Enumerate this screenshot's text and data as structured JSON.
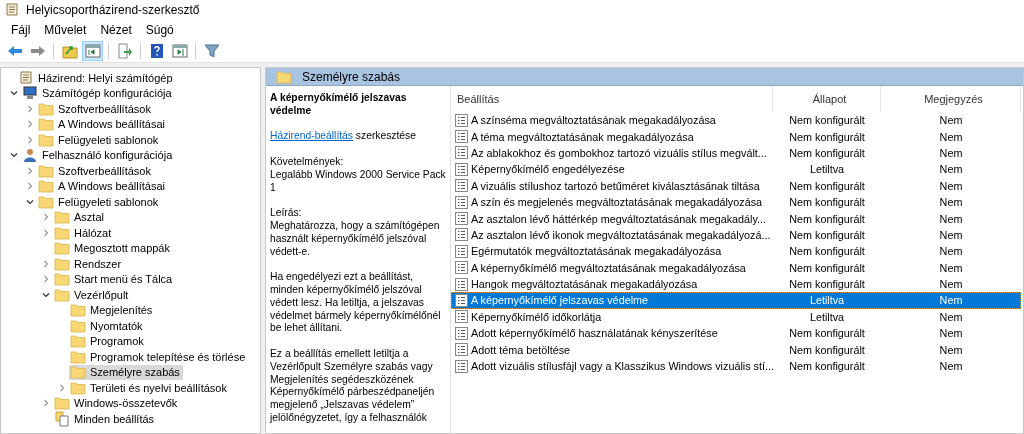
{
  "window": {
    "title": "Helyicsoportházirend-szerkesztő"
  },
  "menu": [
    "Fájl",
    "Művelet",
    "Nézet",
    "Súgó"
  ],
  "toolbar": [
    {
      "kind": "back",
      "pressed": false
    },
    {
      "kind": "forward",
      "pressed": false
    },
    {
      "kind": "separator"
    },
    {
      "kind": "up",
      "pressed": false
    },
    {
      "kind": "tree",
      "pressed": true
    },
    {
      "kind": "separator"
    },
    {
      "kind": "export",
      "pressed": false
    },
    {
      "kind": "separator"
    },
    {
      "kind": "help",
      "pressed": false
    },
    {
      "kind": "pane",
      "pressed": false
    },
    {
      "kind": "separator"
    },
    {
      "kind": "filter",
      "pressed": false
    }
  ],
  "tree": [
    {
      "label": "Házirend: Helyi számítógép",
      "kind": "policy",
      "selected": false,
      "children": [
        {
          "label": "Számítógép konfigurációja",
          "kind": "computer",
          "expanded": true,
          "selected": false,
          "children": [
            {
              "label": "Szoftverbeállítások",
              "kind": "folder",
              "expanded": false,
              "selected": false
            },
            {
              "label": "A Windows beállításai",
              "kind": "folder",
              "expanded": false,
              "selected": false
            },
            {
              "label": "Felügyeleti sablonok",
              "kind": "folder",
              "expanded": false,
              "selected": false
            }
          ]
        },
        {
          "label": "Felhasználó konfigurációja",
          "kind": "user",
          "expanded": true,
          "selected": false,
          "children": [
            {
              "label": "Szoftverbeállítások",
              "kind": "folder",
              "expanded": false,
              "selected": false
            },
            {
              "label": "A Windows beállításai",
              "kind": "folder",
              "expanded": false,
              "selected": false
            },
            {
              "label": "Felügyeleti sablonok",
              "kind": "folder",
              "expanded": true,
              "selected": false,
              "children": [
                {
                  "label": "Asztal",
                  "kind": "folder",
                  "expanded": false,
                  "selected": false
                },
                {
                  "label": "Hálózat",
                  "kind": "folder",
                  "expanded": false,
                  "selected": false
                },
                {
                  "label": "Megosztott mappák",
                  "kind": "folder",
                  "selected": false
                },
                {
                  "label": "Rendszer",
                  "kind": "folder",
                  "expanded": false,
                  "selected": false
                },
                {
                  "label": "Start menü és Tálca",
                  "kind": "folder",
                  "expanded": false,
                  "selected": false
                },
                {
                  "label": "Vezérlőpult",
                  "kind": "folder",
                  "expanded": true,
                  "selected": false,
                  "children": [
                    {
                      "label": "Megjelenítés",
                      "kind": "folder",
                      "selected": false
                    },
                    {
                      "label": "Nyomtatók",
                      "kind": "folder",
                      "selected": false
                    },
                    {
                      "label": "Programok",
                      "kind": "folder",
                      "selected": false
                    },
                    {
                      "label": "Programok telepítése és törlése",
                      "kind": "folder",
                      "selected": false
                    },
                    {
                      "label": "Személyre szabás",
                      "kind": "folder",
                      "selected": true
                    },
                    {
                      "label": "Területi és nyelvi beállítások",
                      "kind": "folder",
                      "expanded": false,
                      "selected": false
                    }
                  ]
                },
                {
                  "label": "Windows-összetevők",
                  "kind": "folder",
                  "expanded": false,
                  "selected": false
                },
                {
                  "label": "Minden beállítás",
                  "kind": "all-settings",
                  "selected": false
                }
              ]
            }
          ]
        }
      ]
    }
  ],
  "panel": {
    "title": "Személyre szabás",
    "description": {
      "title": "A képernyőkímélő jelszavas védelme",
      "link": "Házirend-beállítás",
      "link_suffix": " szerkesztése",
      "paragraphs": [
        "Követelmények:\nLegalább Windows 2000 Service Pack 1",
        "Leírás:\nMeghatározza, hogy a számítógépen használt képernyőkímélő jelszóval védett-e.",
        "Ha engedélyezi ezt a beállítást, minden képernyőkímélő jelszóval védett lesz. Ha letiltja, a jelszavas védelmet bármely képernyőkímélőnél be lehet állítani.",
        "Ez a beállítás emellett letiltja a Vezérlőpult Személyre szabás vagy Megjelenítés segédeszközének Képernyőkímélő párbeszédpaneljén megjelenő „Jelszavas védelem” jelölőnégyzetet, így a felhasználók"
      ]
    },
    "columns": [
      "Beállítás",
      "Állapot",
      "Megjegyzés"
    ],
    "rows": [
      {
        "setting": "A színséma megváltoztatásának megakadályozása",
        "state": "Nem konfigurált",
        "comment": "Nem",
        "selected": false
      },
      {
        "setting": "A téma megváltoztatásának megakadályozása",
        "state": "Nem konfigurált",
        "comment": "Nem",
        "selected": false
      },
      {
        "setting": "Az ablakokhoz és gombokhoz tartozó vizuális stílus megvált...",
        "state": "Nem konfigurált",
        "comment": "Nem",
        "selected": false
      },
      {
        "setting": "Képernyőkímélő engedélyezése",
        "state": "Letiltva",
        "comment": "Nem",
        "selected": false
      },
      {
        "setting": "A vizuális stílushoz tartozó betűméret kiválasztásának tiltása",
        "state": "Nem konfigurált",
        "comment": "Nem",
        "selected": false
      },
      {
        "setting": "A szín és megjelenés megváltoztatásának megakadályozása",
        "state": "Nem konfigurált",
        "comment": "Nem",
        "selected": false
      },
      {
        "setting": "Az asztalon lévő háttérkép megváltoztatásának megakadály...",
        "state": "Nem konfigurált",
        "comment": "Nem",
        "selected": false
      },
      {
        "setting": "Az asztalon lévő ikonok megváltoztatásának megakadályozá...",
        "state": "Nem konfigurált",
        "comment": "Nem",
        "selected": false
      },
      {
        "setting": "Egérmutatók megváltoztatásának megakadályozása",
        "state": "Nem konfigurált",
        "comment": "Nem",
        "selected": false
      },
      {
        "setting": "A képernyőkímélő megváltoztatásának megakadályozása",
        "state": "Nem konfigurált",
        "comment": "Nem",
        "selected": false
      },
      {
        "setting": "Hangok megváltoztatásának megakadályozása",
        "state": "Nem konfigurált",
        "comment": "Nem",
        "selected": false
      },
      {
        "setting": "A képernyőkímélő jelszavas védelme",
        "state": "Letiltva",
        "comment": "Nem",
        "selected": true
      },
      {
        "setting": "Képernyőkímélő időkorlátja",
        "state": "Letiltva",
        "comment": "Nem",
        "selected": false
      },
      {
        "setting": "Adott képernyőkímélő használatának kényszerítése",
        "state": "Nem konfigurált",
        "comment": "Nem",
        "selected": false
      },
      {
        "setting": "Adott téma betöltése",
        "state": "Nem konfigurált",
        "comment": "Nem",
        "selected": false
      },
      {
        "setting": "Adott vizuális stílusfájl vagy a Klasszikus Windows vizuális stí...",
        "state": "Nem konfigurált",
        "comment": "Nem",
        "selected": false
      }
    ]
  }
}
